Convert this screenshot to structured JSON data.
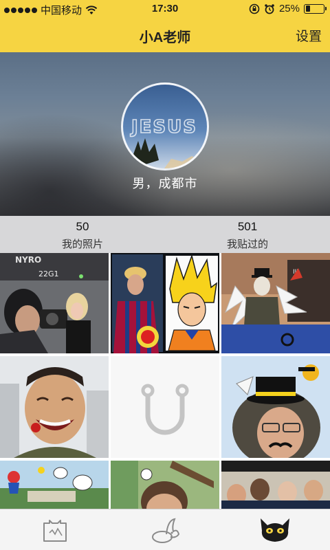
{
  "status_bar": {
    "carrier": "中国移动",
    "time": "17:30",
    "battery": "25%",
    "battery_level": 0.25
  },
  "nav": {
    "title": "小A老师",
    "settings_label": "设置"
  },
  "profile": {
    "avatar_text": "JESUS",
    "info": "男，成都市"
  },
  "stats": {
    "photos": {
      "count": "50",
      "label": "我的照片"
    },
    "stickered": {
      "count": "501",
      "label": "我贴过的"
    }
  },
  "grid": {
    "photo_text_1": "NYRO",
    "photo_text_2": "22G1"
  },
  "tabs": [
    {
      "icon": "photo-frame-icon"
    },
    {
      "icon": "sticker-bunny-icon"
    },
    {
      "icon": "black-cat-icon"
    }
  ],
  "colors": {
    "accent": "#f6d442",
    "stats_bg": "#d7d7d9",
    "tabbar_bg": "#f4f4f4"
  }
}
